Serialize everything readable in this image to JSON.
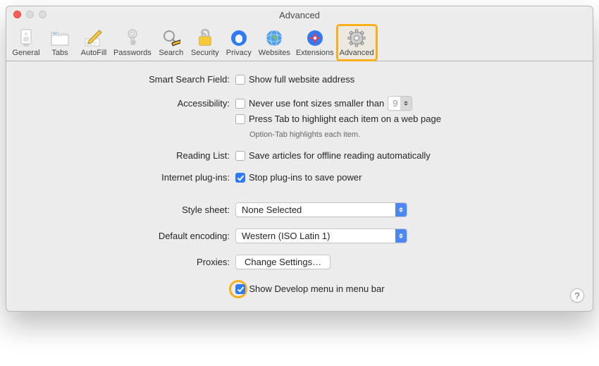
{
  "window": {
    "title": "Advanced"
  },
  "toolbar": {
    "items": [
      {
        "label": "General"
      },
      {
        "label": "Tabs"
      },
      {
        "label": "AutoFill"
      },
      {
        "label": "Passwords"
      },
      {
        "label": "Search"
      },
      {
        "label": "Security"
      },
      {
        "label": "Privacy"
      },
      {
        "label": "Websites"
      },
      {
        "label": "Extensions"
      },
      {
        "label": "Advanced"
      }
    ]
  },
  "sections": {
    "smart_search": {
      "label": "Smart Search Field:",
      "opt_full_address": "Show full website address"
    },
    "accessibility": {
      "label": "Accessibility:",
      "opt_font_size": "Never use font sizes smaller than",
      "font_size_value": "9",
      "opt_press_tab": "Press Tab to highlight each item on a web page",
      "subnote": "Option-Tab highlights each item."
    },
    "reading_list": {
      "label": "Reading List:",
      "opt_save_offline": "Save articles for offline reading automatically"
    },
    "plugins": {
      "label": "Internet plug-ins:",
      "opt_stop": "Stop plug-ins to save power"
    },
    "style_sheet": {
      "label": "Style sheet:",
      "value": "None Selected"
    },
    "encoding": {
      "label": "Default encoding:",
      "value": "Western (ISO Latin 1)"
    },
    "proxies": {
      "label": "Proxies:",
      "button": "Change Settings…"
    },
    "develop": {
      "label": "Show Develop menu in menu bar"
    }
  },
  "help": "?"
}
